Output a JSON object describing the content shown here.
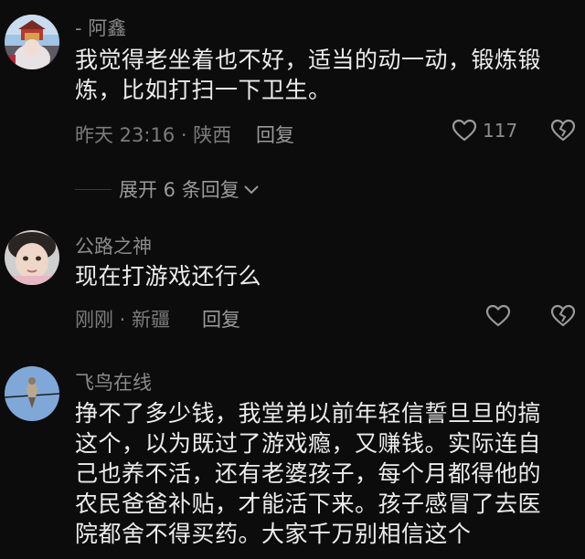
{
  "comments": [
    {
      "author": "- 阿鑫",
      "text_lines": [
        "我觉得老坐着也不好，适当的动一动，锻炼锻",
        "炼，比如打扫一下卫生。"
      ],
      "time": "昨天 23:16 · 陕西",
      "reply_label": "回复",
      "like_count": "117",
      "avatar_icon": "avatar-photo-red-building-icon"
    },
    {
      "author": "公路之神",
      "text_lines": [
        "现在打游戏还行么"
      ],
      "time": "刚刚 · 新疆",
      "reply_label": "回复",
      "like_count": "",
      "avatar_icon": "avatar-photo-child-icon"
    },
    {
      "author": "飞鸟在线",
      "text_lines": [
        "挣不了多少钱，我堂弟以前年轻信誓旦旦的搞",
        "这个，以为既过了游戏瘾，又赚钱。实际连自",
        "己也养不活，还有老婆孩子，每个月都得他的",
        "农民爸爸补贴，才能活下来。孩子感冒了去医",
        "院都舍不得买药。大家千万别相信这个"
      ],
      "avatar_icon": "avatar-photo-bird-on-wire-icon"
    }
  ],
  "expand_replies": {
    "label": "展开 6 条回复",
    "icon": "chevron-down-icon"
  },
  "colors": {
    "background": "#0c0c0c",
    "text": "#ececec",
    "secondary": "#7c7c7c"
  }
}
